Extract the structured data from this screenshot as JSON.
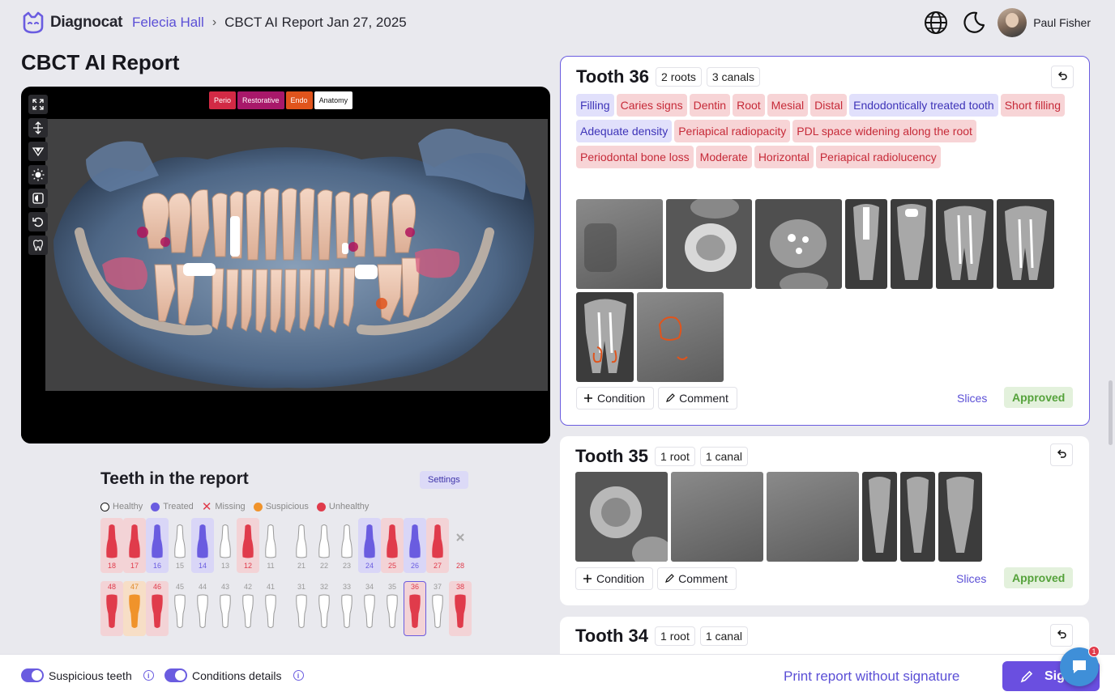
{
  "app": {
    "name": "Diagnocat"
  },
  "breadcrumb": {
    "patient": "Felecia Hall",
    "report": "CBCT AI Report Jan 27, 2025"
  },
  "user": {
    "name": "Paul Fisher"
  },
  "page": {
    "title": "CBCT AI Report"
  },
  "viewer": {
    "layers": [
      {
        "label": "Perio",
        "color": "#d22a45"
      },
      {
        "label": "Restorative",
        "color": "#a8186a"
      },
      {
        "label": "Endo",
        "color": "#e0541c"
      },
      {
        "label": "Anatomy",
        "color": "#ffffff"
      }
    ],
    "tools": [
      "expand-icon",
      "split-vertical-icon",
      "triangle-filter-icon",
      "brightness-icon",
      "contrast-icon",
      "reset-icon",
      "tooth-view-icon"
    ]
  },
  "teeth_chart": {
    "title": "Teeth in the report",
    "settings_label": "Settings",
    "legend": [
      {
        "label": "Healthy",
        "color": "#ffffff"
      },
      {
        "label": "Treated",
        "color": "#6a5ce0"
      },
      {
        "label": "Missing",
        "color": "#e03b4b"
      },
      {
        "label": "Suspicious",
        "color": "#f0932b"
      },
      {
        "label": "Unhealthy",
        "color": "#e03b4b"
      }
    ],
    "upper": [
      {
        "n": "18",
        "s": "unhealthy"
      },
      {
        "n": "17",
        "s": "unhealthy"
      },
      {
        "n": "16",
        "s": "treated"
      },
      {
        "n": "15",
        "s": "healthy"
      },
      {
        "n": "14",
        "s": "treated"
      },
      {
        "n": "13",
        "s": "healthy"
      },
      {
        "n": "12",
        "s": "unhealthy"
      },
      {
        "n": "11",
        "s": "healthy"
      },
      {
        "n": "21",
        "s": "healthy"
      },
      {
        "n": "22",
        "s": "healthy"
      },
      {
        "n": "23",
        "s": "healthy"
      },
      {
        "n": "24",
        "s": "treated"
      },
      {
        "n": "25",
        "s": "unhealthy"
      },
      {
        "n": "26",
        "s": "treated"
      },
      {
        "n": "27",
        "s": "unhealthy"
      },
      {
        "n": "28",
        "s": "missing"
      }
    ],
    "lower": [
      {
        "n": "48",
        "s": "unhealthy"
      },
      {
        "n": "47",
        "s": "suspicious"
      },
      {
        "n": "46",
        "s": "unhealthy"
      },
      {
        "n": "45",
        "s": "healthy"
      },
      {
        "n": "44",
        "s": "healthy"
      },
      {
        "n": "43",
        "s": "healthy"
      },
      {
        "n": "42",
        "s": "healthy"
      },
      {
        "n": "41",
        "s": "healthy"
      },
      {
        "n": "31",
        "s": "healthy"
      },
      {
        "n": "32",
        "s": "healthy"
      },
      {
        "n": "33",
        "s": "healthy"
      },
      {
        "n": "34",
        "s": "healthy"
      },
      {
        "n": "35",
        "s": "healthy"
      },
      {
        "n": "36",
        "s": "selected"
      },
      {
        "n": "37",
        "s": "healthy"
      },
      {
        "n": "38",
        "s": "unhealthy"
      }
    ]
  },
  "cards": [
    {
      "title": "Tooth 36",
      "roots": "2 roots",
      "canals": "3 canals",
      "tags": [
        {
          "t": "Filling",
          "c": "purple"
        },
        {
          "t": "Caries signs",
          "c": "red"
        },
        {
          "t": "Dentin",
          "c": "red"
        },
        {
          "t": "Root",
          "c": "red"
        },
        {
          "t": "Mesial",
          "c": "red"
        },
        {
          "t": "Distal",
          "c": "red"
        },
        {
          "t": "Endodontically treated tooth",
          "c": "purple"
        },
        {
          "t": "Short filling",
          "c": "red"
        },
        {
          "t": "Adequate density",
          "c": "purple"
        },
        {
          "t": "Periapical radiopacity",
          "c": "red"
        },
        {
          "t": "PDL space widening along the root",
          "c": "red"
        },
        {
          "t": "Periodontal bone loss",
          "c": "red"
        },
        {
          "t": "Moderate",
          "c": "red"
        },
        {
          "t": "Horizontal",
          "c": "red"
        },
        {
          "t": "Periapical radiolucency",
          "c": "red"
        }
      ],
      "condition_label": "Condition",
      "comment_label": "Comment",
      "slices_label": "Slices",
      "status": "Approved"
    },
    {
      "title": "Tooth 35",
      "roots": "1 root",
      "canals": "1 canal",
      "condition_label": "Condition",
      "comment_label": "Comment",
      "slices_label": "Slices",
      "status": "Approved"
    },
    {
      "title": "Tooth 34",
      "roots": "1 root",
      "canals": "1 canal"
    }
  ],
  "bottom": {
    "suspicious_teeth": "Suspicious teeth",
    "conditions_details": "Conditions details",
    "print_label": "Print report without signature",
    "sign_label": "Sig",
    "chat_badge": "1"
  }
}
